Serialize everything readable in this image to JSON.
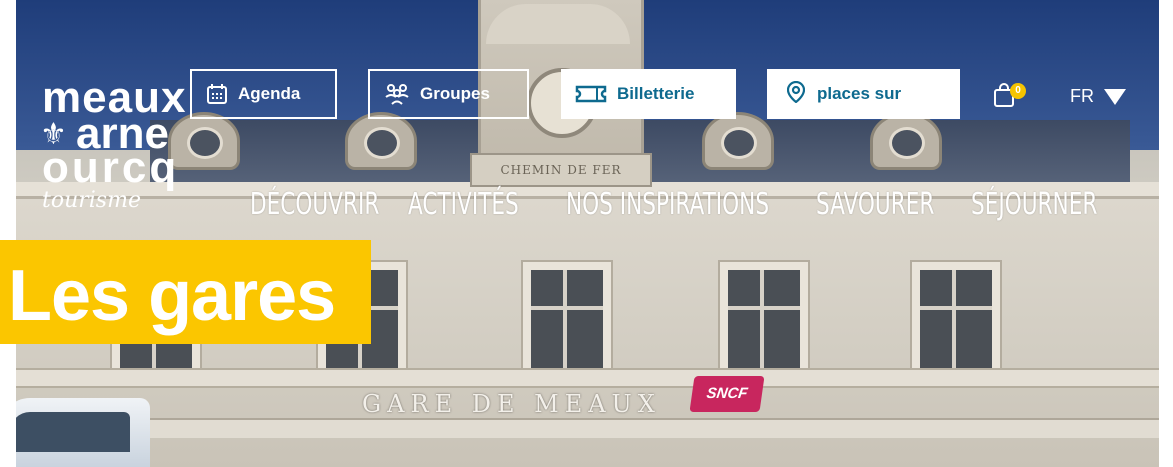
{
  "logo": {
    "line1": "meaux",
    "line2": "arne",
    "line3": "ourcq",
    "line4": "tourisme"
  },
  "header": {
    "agenda_label": "Agenda",
    "groupes_label": "Groupes",
    "billetterie_label": "Billetterie",
    "search_placeholder": "places sur",
    "cart_count": "0",
    "language": "FR"
  },
  "nav": {
    "items": [
      {
        "label": "DÉCOUVRIR"
      },
      {
        "label": "ACTIVITÉS"
      },
      {
        "label": "NOS INSPIRATIONS"
      },
      {
        "label": "SAVOURER"
      },
      {
        "label": "SÉJOURNER"
      }
    ]
  },
  "hero": {
    "title": "Les gares",
    "plaque_text": "CHEMIN DE FER",
    "station_sign": "GARE DE MEAUX",
    "sncf_logo": "SNCF"
  },
  "colors": {
    "accent_yellow": "#fbc600",
    "link_blue": "#0e6a8f",
    "badge_yellow": "#f5c400"
  },
  "icons": [
    "calendar-icon",
    "group-icon",
    "ticket-icon",
    "location-pin-icon",
    "shopping-bag-icon",
    "caret-down-icon"
  ]
}
